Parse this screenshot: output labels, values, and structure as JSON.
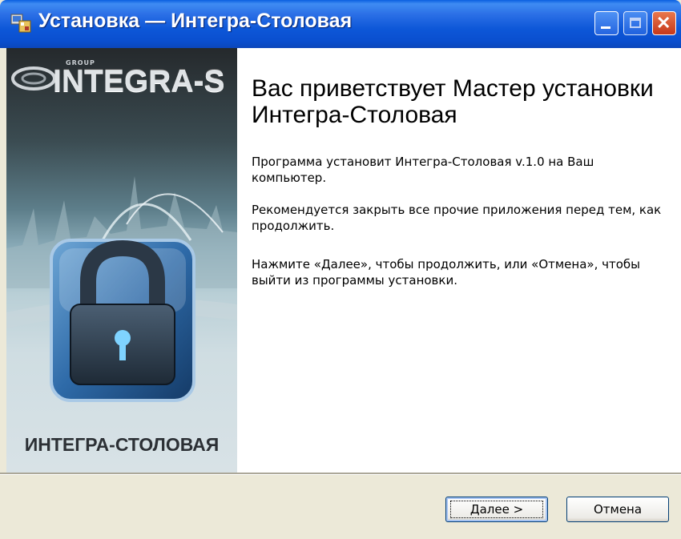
{
  "window": {
    "title": "Установка — Интегра-Столовая",
    "controls": {
      "minimize": "minimize",
      "maximize": "maximize",
      "close": "close"
    }
  },
  "banner": {
    "logo_top": "GROUP",
    "logo": "INTEGRA-S",
    "product": "ИНТЕГРА-СТОЛОВАЯ",
    "icon": "padlock-icon"
  },
  "content": {
    "title": "Вас приветствует Мастер установки Интегра-Столовая",
    "paragraphs": [
      "Программа установит Интегра-Столовая v.1.0 на Ваш компьютер.",
      "Рекомендуется закрыть все прочие приложения перед тем, как продолжить.",
      "Нажмите «Далее», чтобы продолжить, или «Отмена», чтобы выйти из программы установки."
    ]
  },
  "buttons": {
    "next_accel": "Д",
    "next_rest": "алее >",
    "cancel": "Отмена"
  },
  "colors": {
    "titlebar": "#0a57d8",
    "dialog_face": "#ece9d8",
    "close_button": "#c6381b"
  }
}
